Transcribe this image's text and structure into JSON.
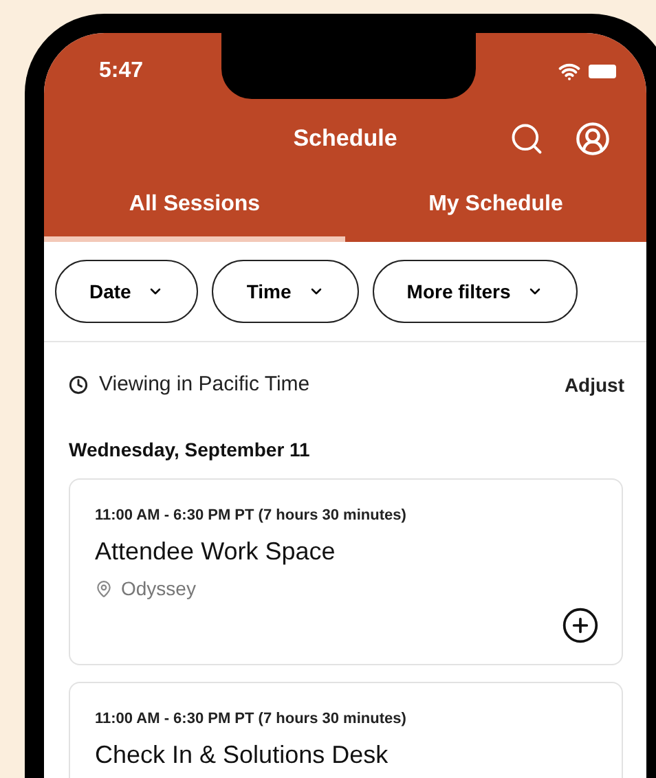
{
  "status_bar": {
    "time": "5:47"
  },
  "header": {
    "title": "Schedule"
  },
  "tabs": [
    {
      "label": "All Sessions",
      "selected": true
    },
    {
      "label": "My Schedule",
      "selected": false
    }
  ],
  "filters": [
    {
      "label": "Date"
    },
    {
      "label": "Time"
    },
    {
      "label": "More filters"
    }
  ],
  "timezone": {
    "text": "Viewing in Pacific Time",
    "action": "Adjust"
  },
  "day_heading": "Wednesday, September 11",
  "sessions": [
    {
      "time": "11:00 AM - 6:30 PM PT (7 hours 30 minutes)",
      "title": "Attendee Work Space",
      "location": "Odyssey"
    },
    {
      "time": "11:00 AM - 6:30 PM PT (7 hours 30 minutes)",
      "title": "Check In & Solutions Desk"
    }
  ]
}
